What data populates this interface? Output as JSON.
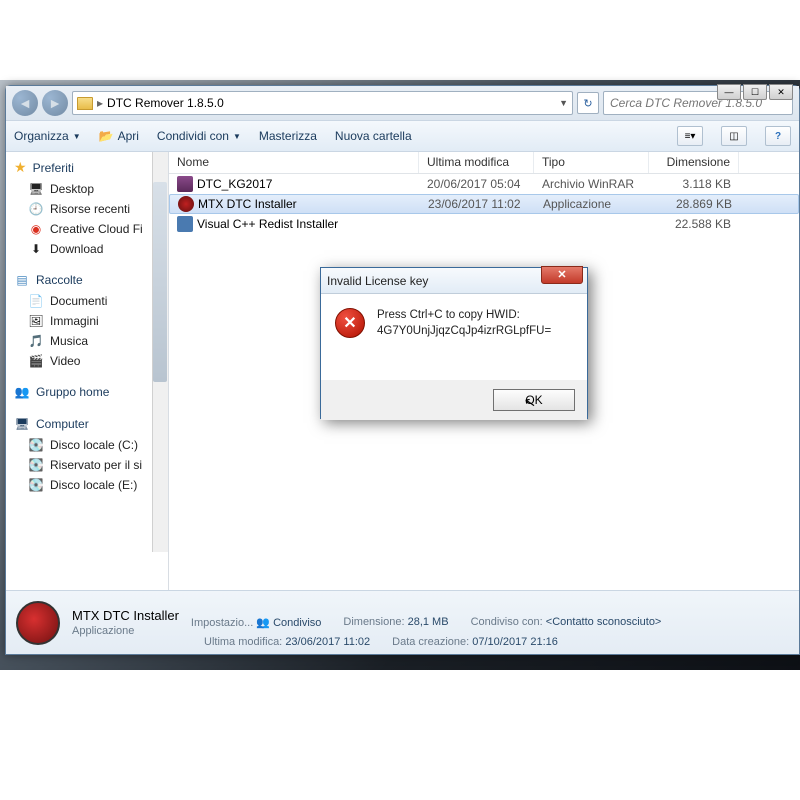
{
  "window": {
    "breadcrumb": "DTC Remover 1.8.5.0",
    "search_placeholder": "Cerca DTC Remover 1.8.5.0"
  },
  "toolbar": {
    "organize": "Organizza",
    "open": "Apri",
    "share": "Condividi con",
    "burn": "Masterizza",
    "newfolder": "Nuova cartella"
  },
  "sidebar": {
    "fav_header": "Preferiti",
    "fav": [
      "Desktop",
      "Risorse recenti",
      "Creative Cloud Fi",
      "Download"
    ],
    "lib_header": "Raccolte",
    "lib": [
      "Documenti",
      "Immagini",
      "Musica",
      "Video"
    ],
    "home": "Gruppo home",
    "comp_header": "Computer",
    "comp": [
      "Disco locale (C:)",
      "Riservato per il si",
      "Disco locale (E:)"
    ]
  },
  "columns": {
    "name": "Nome",
    "mod": "Ultima modifica",
    "type": "Tipo",
    "size": "Dimensione"
  },
  "files": [
    {
      "name": "DTC_KG2017",
      "mod": "20/06/2017 05:04",
      "type": "Archivio WinRAR",
      "size": "3.118 KB"
    },
    {
      "name": "MTX DTC Installer",
      "mod": "23/06/2017 11:02",
      "type": "Applicazione",
      "size": "28.869 KB"
    },
    {
      "name": "Visual C++ Redist Installer",
      "mod": "",
      "type": "",
      "size": "22.588 KB"
    }
  ],
  "details": {
    "title": "MTX DTC Installer",
    "subtitle": "Applicazione",
    "setting_label": "Impostazio...",
    "setting_val": "Condiviso",
    "mod_label": "Ultima modifica:",
    "mod_val": "23/06/2017 11:02",
    "size_label": "Dimensione:",
    "size_val": "28,1 MB",
    "created_label": "Data creazione:",
    "created_val": "07/10/2017 21:16",
    "shared_label": "Condiviso con:",
    "shared_val": "<Contatto sconosciuto>"
  },
  "dialog": {
    "title": "Invalid License key",
    "msg1": "Press Ctrl+C to copy HWID:",
    "msg2": "4G7Y0UnjJjqzCqJp4izrRGLpfFU=",
    "ok": "OK"
  }
}
